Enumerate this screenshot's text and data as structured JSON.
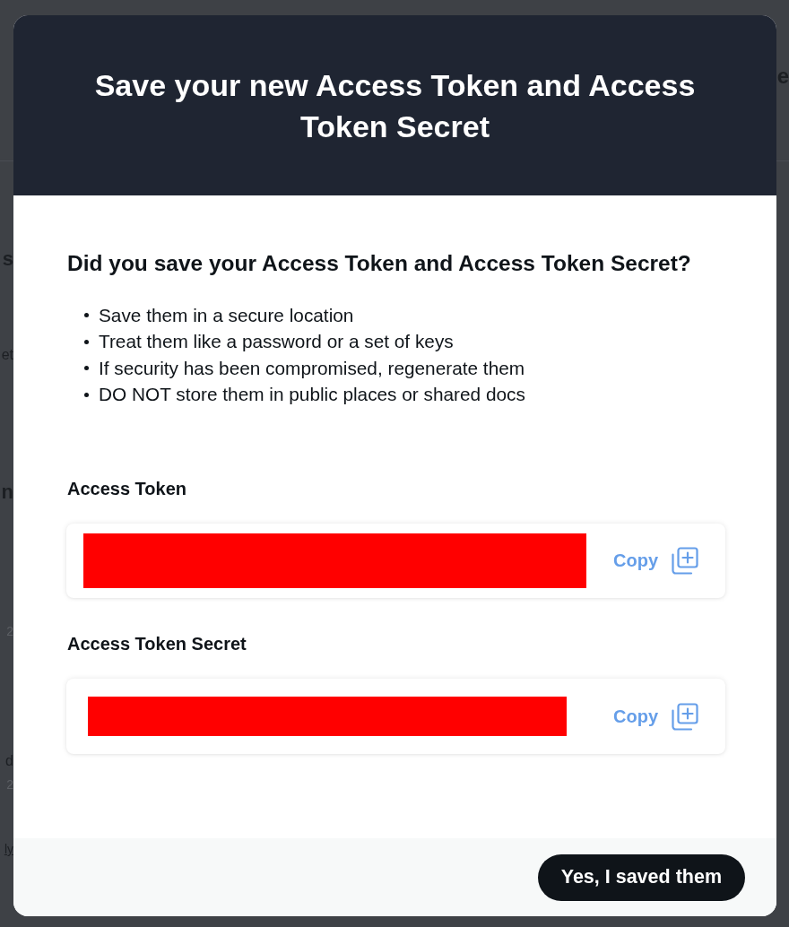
{
  "backdrop": {
    "header_fragment": "e",
    "side_fragments": [
      {
        "text": "s",
        "kind": "heading"
      },
      {
        "text": "et",
        "kind": "text"
      },
      {
        "text": "n",
        "kind": "heading"
      },
      {
        "text": "2",
        "kind": "meta"
      },
      {
        "text": "d",
        "kind": "text"
      },
      {
        "text": "2",
        "kind": "meta"
      },
      {
        "text": "ly",
        "kind": "link"
      }
    ]
  },
  "dialog": {
    "title": "Save your new Access Token and Access Token Secret",
    "question": "Did you save your Access Token and Access Token Secret?",
    "tips": [
      "Save them in a secure location",
      "Treat them like a password or a set of keys",
      "If security has been compromised, regenerate them",
      "DO NOT store them in public places or shared docs"
    ],
    "fields": [
      {
        "label": "Access Token",
        "redacted": true,
        "copy_label": "Copy"
      },
      {
        "label": "Access Token Secret",
        "redacted": true,
        "copy_label": "Copy"
      }
    ],
    "confirm_button": "Yes, I saved them"
  }
}
